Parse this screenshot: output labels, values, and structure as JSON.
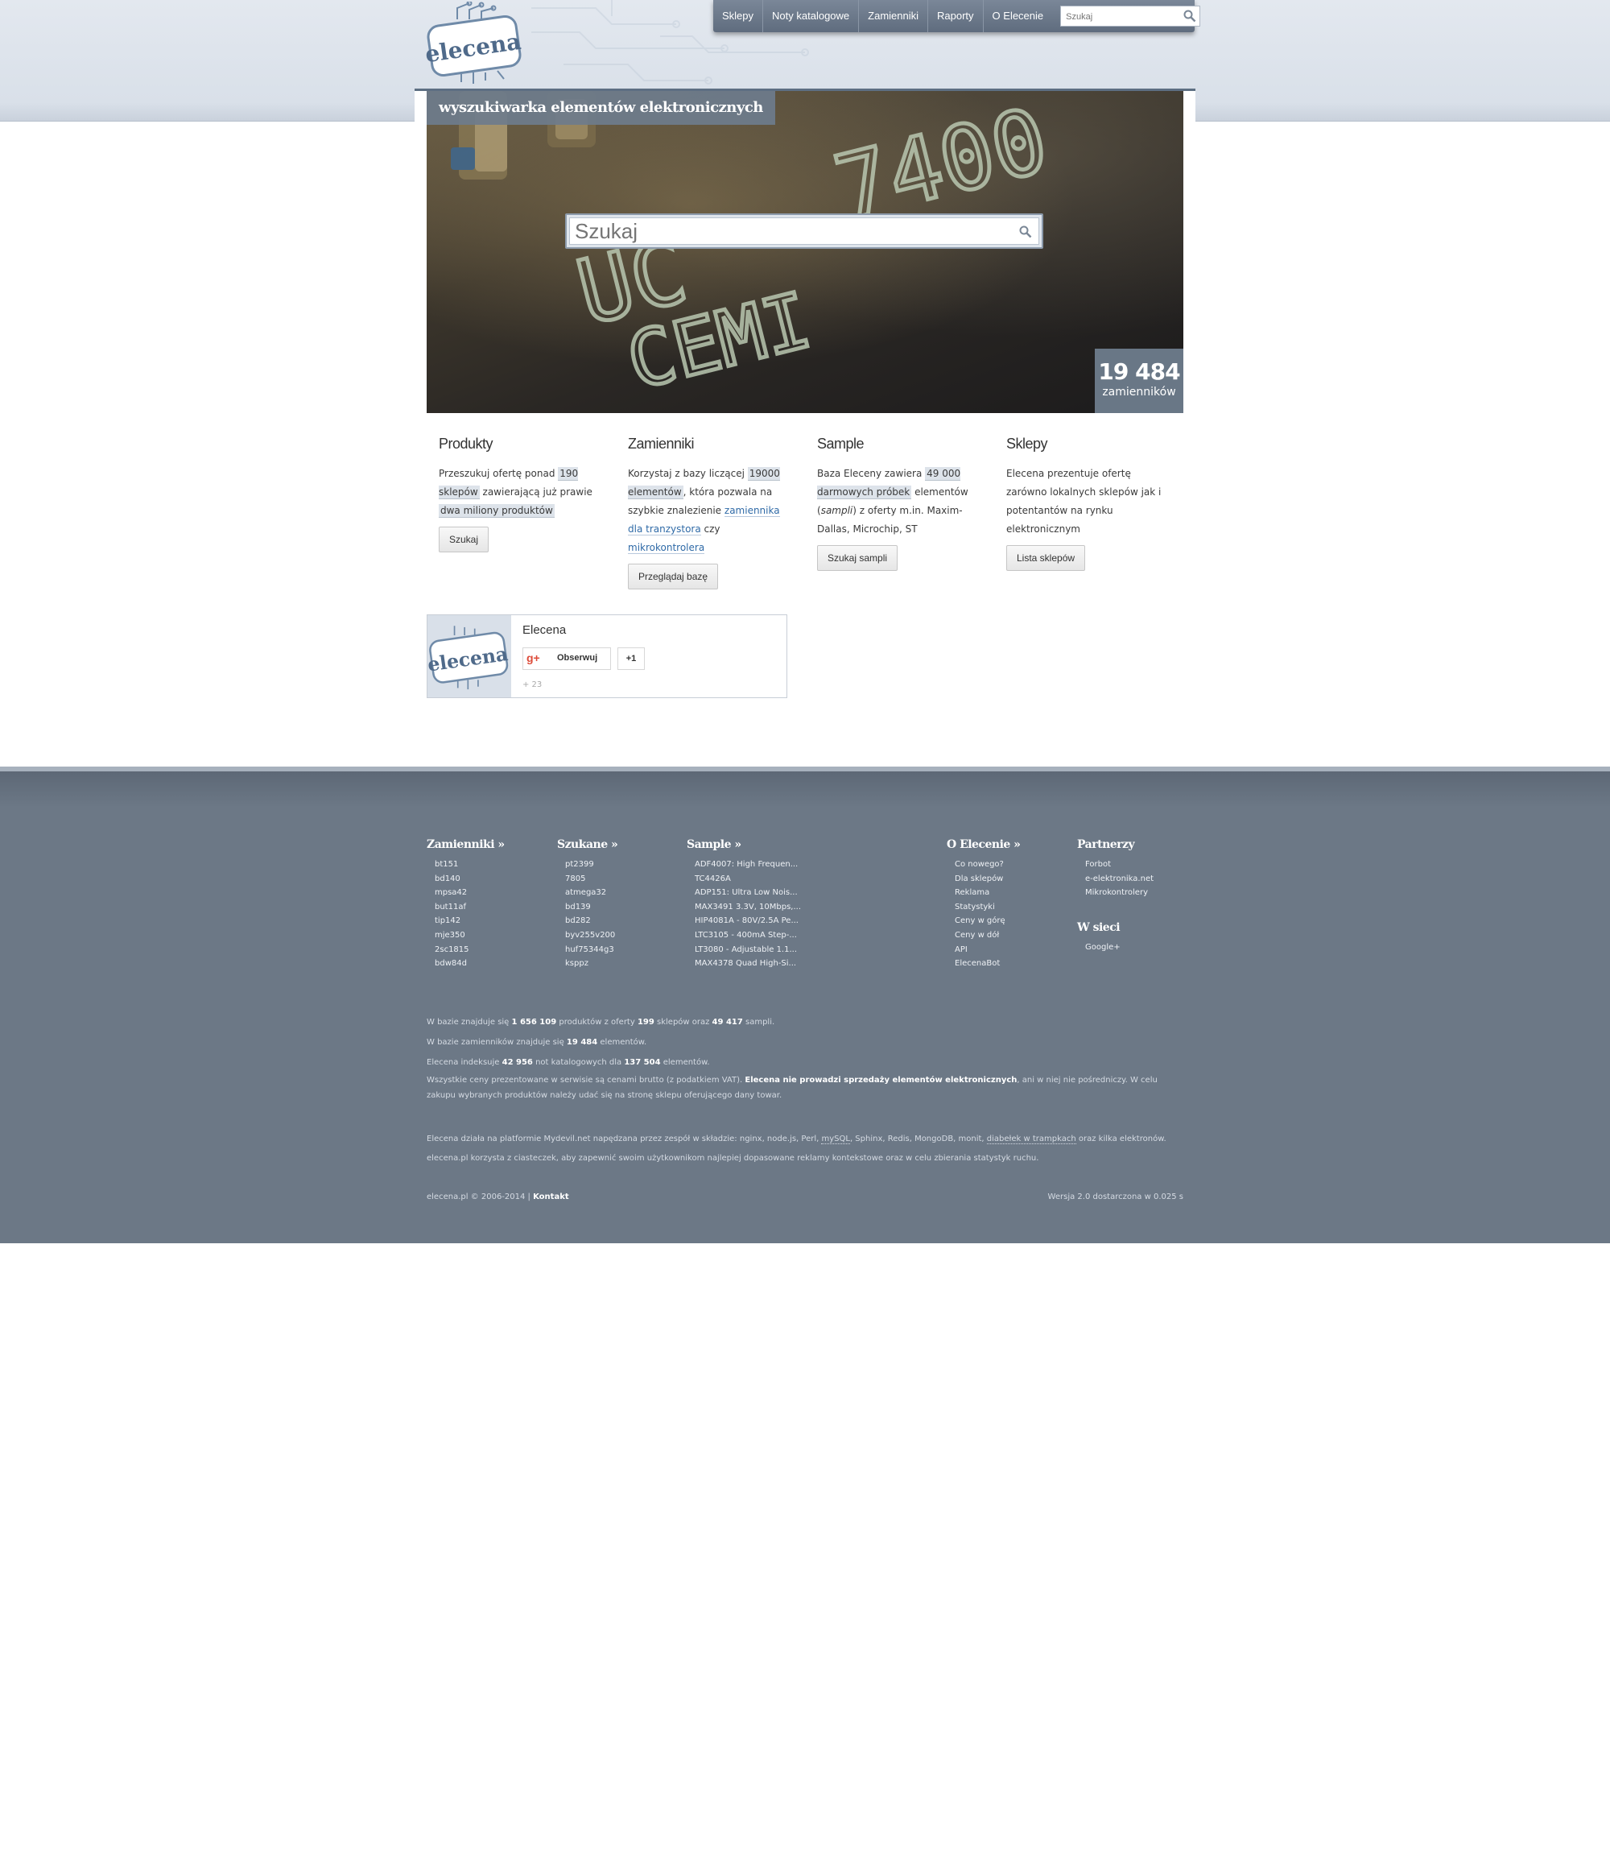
{
  "brand": {
    "logo_text": "elecena",
    "tagline": "wyszukiwarka elementów elektronicznych"
  },
  "nav": {
    "items": [
      "Sklepy",
      "Noty katalogowe",
      "Zamienniki",
      "Raporty",
      "O Elecenie"
    ],
    "search_placeholder": "Szukaj"
  },
  "hero": {
    "search_placeholder": "Szukaj",
    "counter_value": "19 484",
    "counter_label": "zamienników",
    "photo_text": [
      "7400",
      "UC",
      "CEMI"
    ]
  },
  "features": [
    {
      "title": "Produkty",
      "t1": "Przeszukuj ofertę ponad ",
      "h1": "190 sklepów",
      "t2": " zawierającą już prawie ",
      "h2": "dwa miliony produktów",
      "button": "Szukaj"
    },
    {
      "title": "Zamienniki",
      "t1": "Korzystaj z bazy liczącej ",
      "h1": "19000 elementów",
      "t2": ", która pozwala na szybkie znalezienie ",
      "l1": "zamiennika dla tranzystora",
      "t3": " czy ",
      "l2": "mikrokontrolera",
      "button": "Przeglądaj bazę"
    },
    {
      "title": "Sample",
      "t1": "Baza Eleceny zawiera ",
      "h1": "49 000 darmowych próbek",
      "t2": " elementów (",
      "em": "sampli",
      "t3": ") z oferty m.in. Maxim-Dallas, Microchip, ST",
      "button": "Szukaj sampli"
    },
    {
      "title": "Sklepy",
      "t1": "Elecena prezentuje ofertę zarówno lokalnych sklepów jak i potentantów na rynku elektronicznym",
      "button": "Lista sklepów"
    }
  ],
  "gplus": {
    "name": "Elecena",
    "follow": "Obserwuj",
    "plusone": "+1",
    "count": "+ 23",
    "g_logo": "g+"
  },
  "footer": {
    "columns": [
      {
        "title": "Zamienniki »",
        "items": [
          "bt151",
          "bd140",
          "mpsa42",
          "but11af",
          "tip142",
          "mje350",
          "2sc1815",
          "bdw84d"
        ]
      },
      {
        "title": "Szukane »",
        "items": [
          "pt2399",
          "7805",
          "atmega32",
          "bd139",
          "bd282",
          "byv255v200",
          "huf75344g3",
          "ksppz"
        ]
      },
      {
        "title": "Sample »",
        "items": [
          "ADF4007: High Frequen...",
          "TC4426A",
          "ADP151: Ultra Low Nois...",
          "MAX3491 3.3V, 10Mbps,...",
          "HIP4081A - 80V/2.5A Pe...",
          "LTC3105 - 400mA Step-...",
          "LT3080 - Adjustable 1.1...",
          "MAX4378 Quad High-Si..."
        ]
      },
      {
        "title": "O Elecenie »",
        "items": [
          "Co nowego?",
          "Dla sklepów",
          "Reklama",
          "Statystyki",
          "Ceny w górę",
          "Ceny w dół",
          "API",
          "ElecenaBot"
        ]
      },
      {
        "title": "Partnerzy",
        "items": [
          "Forbot",
          "e-elektronika.net",
          "Mikrokontrolery"
        ]
      },
      {
        "title": "W sieci",
        "items": [
          "Google+"
        ]
      }
    ],
    "stats": {
      "l1a": "W bazie znajduje się ",
      "l1b": "1 656 109",
      "l1c": " produktów z oferty ",
      "l1d": "199",
      "l1e": " sklepów oraz ",
      "l1f": "49 417",
      "l1g": " sampli.",
      "l2a": "W bazie zamienników znajduje się ",
      "l2b": "19 484",
      "l2c": " elementów.",
      "l3a": "Elecena indeksuje ",
      "l3b": "42 956",
      "l3c": " not katalogowych dla ",
      "l3d": "137 504",
      "l3e": " elementów.",
      "l4a": "Wszystkie ceny prezentowane w serwisie są cenami brutto (z podatkiem VAT). ",
      "l4b": "Elecena nie prowadzi sprzedaży elementów elektronicznych",
      "l4c": ", ani w niej nie pośredniczy. W celu zakupu wybranych produktów należy udać się na stronę sklepu oferującego dany towar."
    },
    "tech": {
      "a": "Elecena działa na platformie Mydevil.net napędzana przez zespół w składzie: nginx, node.js, Perl, ",
      "mysql": "mySQL",
      "b": ", Sphinx, Redis, MongoDB, monit, ",
      "diab": "diabełek w trampkach",
      "c": " oraz kilka elektronów.",
      "cookies": "elecena.pl korzysta z ciasteczek, aby zapewnić swoim użytkownikom najlepiej dopasowane reklamy kontekstowe oraz w celu zbierania statystyk ruchu."
    },
    "copyright": "elecena.pl © 2006-2014 | ",
    "contact": "Kontakt",
    "version": "Wersja 2.0 dostarczona w 0.025 s"
  },
  "colors": {
    "nav_bg": "#6b7888",
    "footer_bg": "#6c7886",
    "link": "#2f6aa7",
    "highlight": "#dde3ea"
  },
  "icons": [
    "search-icon",
    "logo-chip-icon",
    "google-plus-icon"
  ]
}
